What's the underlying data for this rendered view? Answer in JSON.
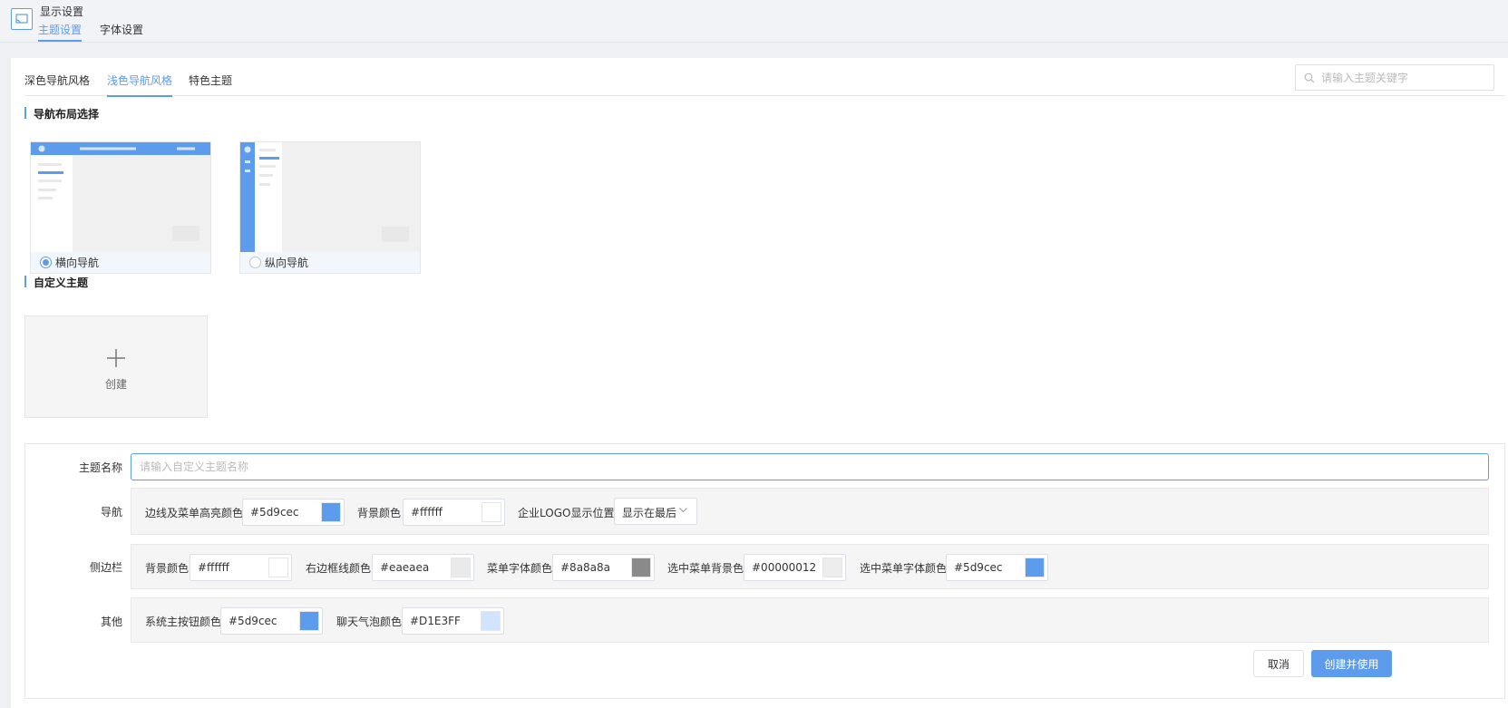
{
  "header": {
    "title": "显示设置",
    "subtabs": [
      {
        "label": "主题设置",
        "active": true
      },
      {
        "label": "字体设置",
        "active": false
      }
    ]
  },
  "tabs": [
    {
      "label": "深色导航风格",
      "active": false
    },
    {
      "label": "浅色导航风格",
      "active": true
    },
    {
      "label": "特色主题",
      "active": false
    }
  ],
  "search": {
    "placeholder": "请输入主题关键字",
    "icon": "search-icon"
  },
  "layout_section": {
    "title": "导航布局选择",
    "options": [
      {
        "label": "横向导航",
        "selected": true
      },
      {
        "label": "纵向导航",
        "selected": false
      }
    ]
  },
  "custom_section": {
    "title": "自定义主题",
    "create_label": "创建",
    "create_icon": "plus-icon"
  },
  "form": {
    "name_label": "主题名称",
    "name_placeholder": "请输入自定义主题名称",
    "nav": {
      "label": "导航",
      "fields": [
        {
          "label": "边线及菜单高亮颜色",
          "value": "#5d9cec",
          "swatch": "#5d9cec"
        },
        {
          "label": "背景颜色",
          "value": "#ffffff",
          "swatch": "#ffffff"
        }
      ],
      "logo_label": "企业LOGO显示位置",
      "logo_value": "显示在最后"
    },
    "sidebar": {
      "label": "侧边栏",
      "fields": [
        {
          "label": "背景颜色",
          "value": "#ffffff",
          "swatch": "#ffffff"
        },
        {
          "label": "右边框线颜色",
          "value": "#eaeaea",
          "swatch": "#eaeaea"
        },
        {
          "label": "菜单字体颜色",
          "value": "#8a8a8a",
          "swatch": "#8a8a8a"
        },
        {
          "label": "选中菜单背景色",
          "value": "#00000012",
          "swatch": "#ededed"
        },
        {
          "label": "选中菜单字体颜色",
          "value": "#5d9cec",
          "swatch": "#5d9cec"
        }
      ]
    },
    "other": {
      "label": "其他",
      "fields": [
        {
          "label": "系统主按钮颜色",
          "value": "#5d9cec",
          "swatch": "#5d9cec"
        },
        {
          "label": "聊天气泡颜色",
          "value": "#D1E3FF",
          "swatch": "#D1E3FF"
        }
      ]
    },
    "cancel_label": "取消",
    "submit_label": "创建并使用"
  },
  "colors": {
    "accent": "#5d9cec"
  }
}
